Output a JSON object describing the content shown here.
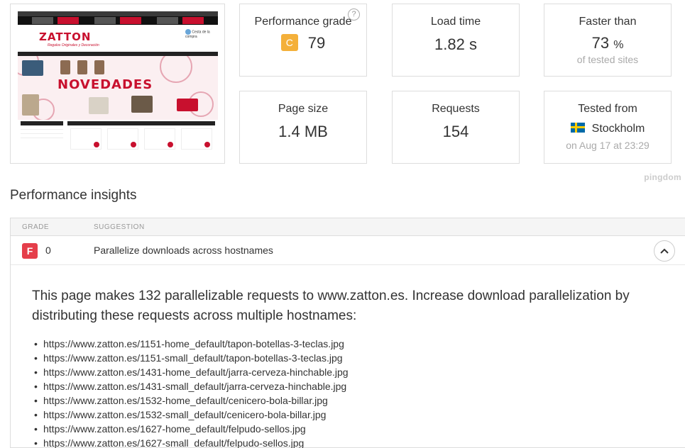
{
  "stats": {
    "grade": {
      "label": "Performance grade",
      "letter": "C",
      "value": "79",
      "help": "?"
    },
    "load": {
      "label": "Load time",
      "value": "1.82 s"
    },
    "faster": {
      "label": "Faster than",
      "value": "73",
      "unit": "%",
      "sub": "of tested sites"
    },
    "size": {
      "label": "Page size",
      "value": "1.4 MB"
    },
    "requests": {
      "label": "Requests",
      "value": "154"
    },
    "tested": {
      "label": "Tested from",
      "location": "Stockholm",
      "date": "on Aug 17 at 23:29"
    }
  },
  "thumbnail": {
    "logo": "ZATTON",
    "logo_sub": "Regalos Originales y Decoración",
    "banner": "NOVEDADES",
    "cart": "Cesta de la compra"
  },
  "brand": "pingdom",
  "insights": {
    "title": "Performance insights",
    "col_grade": "GRADE",
    "col_suggestion": "SUGGESTION",
    "row": {
      "grade": "F",
      "score": "0",
      "suggestion": "Parallelize downloads across hostnames",
      "toggle": "^"
    },
    "description": "This page makes 132 parallelizable requests to www.zatton.es. Increase download parallelization by distributing these requests across multiple hostnames:",
    "urls": [
      "https://www.zatton.es/1151-home_default/tapon-botellas-3-teclas.jpg",
      "https://www.zatton.es/1151-small_default/tapon-botellas-3-teclas.jpg",
      "https://www.zatton.es/1431-home_default/jarra-cerveza-hinchable.jpg",
      "https://www.zatton.es/1431-small_default/jarra-cerveza-hinchable.jpg",
      "https://www.zatton.es/1532-home_default/cenicero-bola-billar.jpg",
      "https://www.zatton.es/1532-small_default/cenicero-bola-billar.jpg",
      "https://www.zatton.es/1627-home_default/felpudo-sellos.jpg",
      "https://www.zatton.es/1627-small_default/felpudo-sellos.jpg"
    ]
  }
}
